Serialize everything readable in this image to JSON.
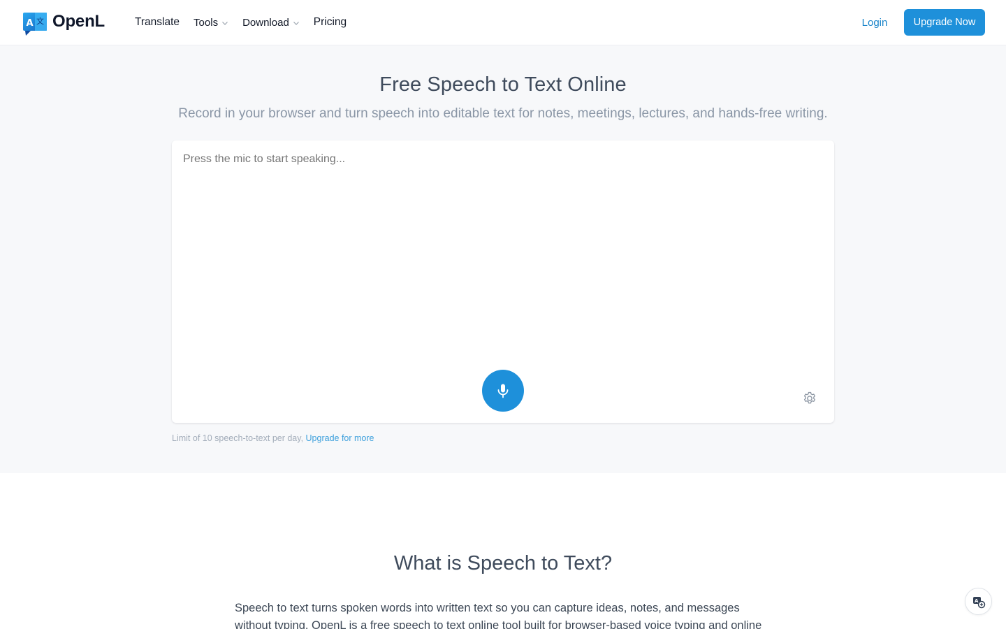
{
  "brand": {
    "name": "OpenL",
    "logo_glyph_left": "A",
    "logo_glyph_right": "文"
  },
  "nav": {
    "translate": "Translate",
    "tools": "Tools",
    "download": "Download",
    "pricing": "Pricing"
  },
  "header": {
    "login": "Login",
    "upgrade": "Upgrade Now"
  },
  "hero": {
    "title": "Free Speech to Text Online",
    "subtitle": "Record in your browser and turn speech into editable text for notes, meetings, lectures, and hands-free writing."
  },
  "editor": {
    "placeholder": "Press the mic to start speaking...",
    "value": ""
  },
  "limit": {
    "text": "Limit of 10 speech-to-text per day, ",
    "link": "Upgrade for more"
  },
  "section": {
    "title": "What is Speech to Text?",
    "paragraph": "Speech to text turns spoken words into written text so you can capture ideas, notes, and messages without typing. OpenL is a free speech to text online tool built for browser-based voice typing and online"
  },
  "icons": {
    "logo": "openl-logo-icon",
    "chevron": "chevron-down-icon",
    "mic": "microphone-icon",
    "settings": "gear-icon",
    "helper": "translate-helper-icon"
  },
  "colors": {
    "accent": "#1e90da",
    "link": "#1783c9",
    "hero_bg": "#f7f8fa"
  }
}
